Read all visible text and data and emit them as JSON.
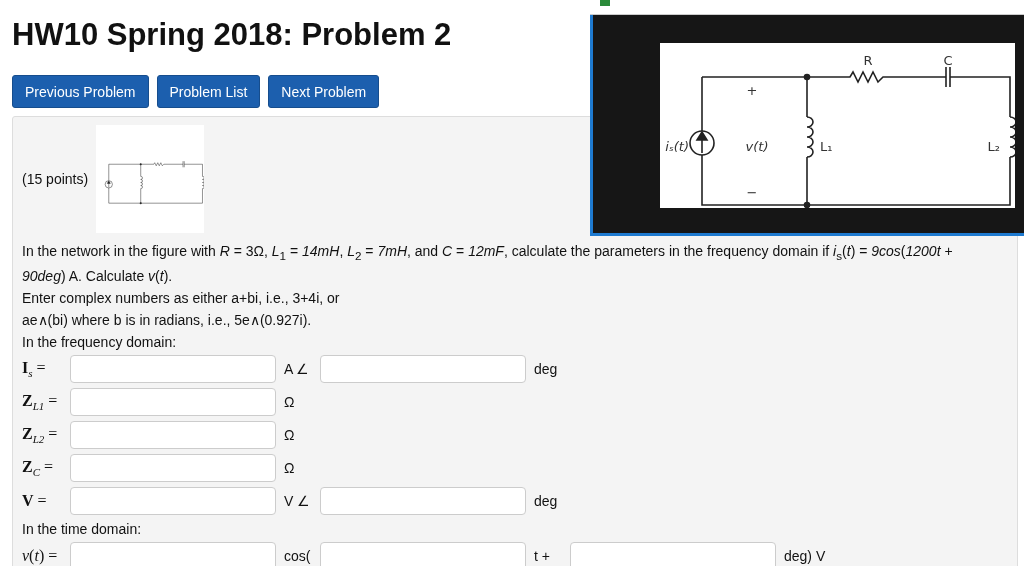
{
  "title": "HW10 Spring 2018: Problem 2",
  "nav_buttons": [
    "Previous Problem",
    "Problem List",
    "Next Problem"
  ],
  "problem": {
    "points": "(15 points)",
    "statement": "In the network in the figure with *R* = 3Ω, *L*$_{1}$ = *14mH*, *L*$_{2}$ = *7mH*, and *C* = *12mF*, calculate the parameters in the frequency domain if *i*$_{s}$(*t*) = *9cos*(*1200t* + *90deg*) A. Calculate *v*(*t*).",
    "instructions": [
      "Enter complex numbers as either a+bi, i.e., 3+4i, or",
      "ae∧(bi) where b is in radians, i.e., 5e∧(0.927i)."
    ],
    "frequency_heading": "In the frequency domain:",
    "frequency_rows": [
      {
        "parts": [
          {
            "kind": "label",
            "text": "**I**$_{s}$ ="
          },
          {
            "kind": "input"
          },
          {
            "kind": "text",
            "text": "A ∠"
          },
          {
            "kind": "input"
          },
          {
            "kind": "text",
            "text": "deg"
          }
        ]
      },
      {
        "parts": [
          {
            "kind": "label",
            "text": "**Z**$_{L1}$ ="
          },
          {
            "kind": "input"
          },
          {
            "kind": "text",
            "text": "Ω"
          }
        ]
      },
      {
        "parts": [
          {
            "kind": "label",
            "text": "**Z**$_{L2}$ ="
          },
          {
            "kind": "input"
          },
          {
            "kind": "text",
            "text": "Ω"
          }
        ]
      },
      {
        "parts": [
          {
            "kind": "label",
            "text": "**Z**$_{C}$ ="
          },
          {
            "kind": "input"
          },
          {
            "kind": "text",
            "text": "Ω"
          }
        ]
      },
      {
        "parts": [
          {
            "kind": "label",
            "text": "**V** ="
          },
          {
            "kind": "input"
          },
          {
            "kind": "text",
            "text": "V ∠"
          },
          {
            "kind": "input"
          },
          {
            "kind": "text",
            "text": "deg"
          }
        ]
      }
    ],
    "time_heading": "In the time domain:",
    "time_rows": [
      {
        "parts": [
          {
            "kind": "label",
            "text": "*v*(*t*) ="
          },
          {
            "kind": "input"
          },
          {
            "kind": "text",
            "text": "cos("
          },
          {
            "kind": "input"
          },
          {
            "kind": "text",
            "text": "t +"
          },
          {
            "kind": "input"
          },
          {
            "kind": "text",
            "text": "deg) V"
          }
        ]
      }
    ]
  },
  "enlarged_figure": {
    "labels": [
      "R",
      "C",
      "+",
      "iₛ(t)",
      "v(t)",
      "L₁",
      "L₂",
      "−"
    ]
  }
}
